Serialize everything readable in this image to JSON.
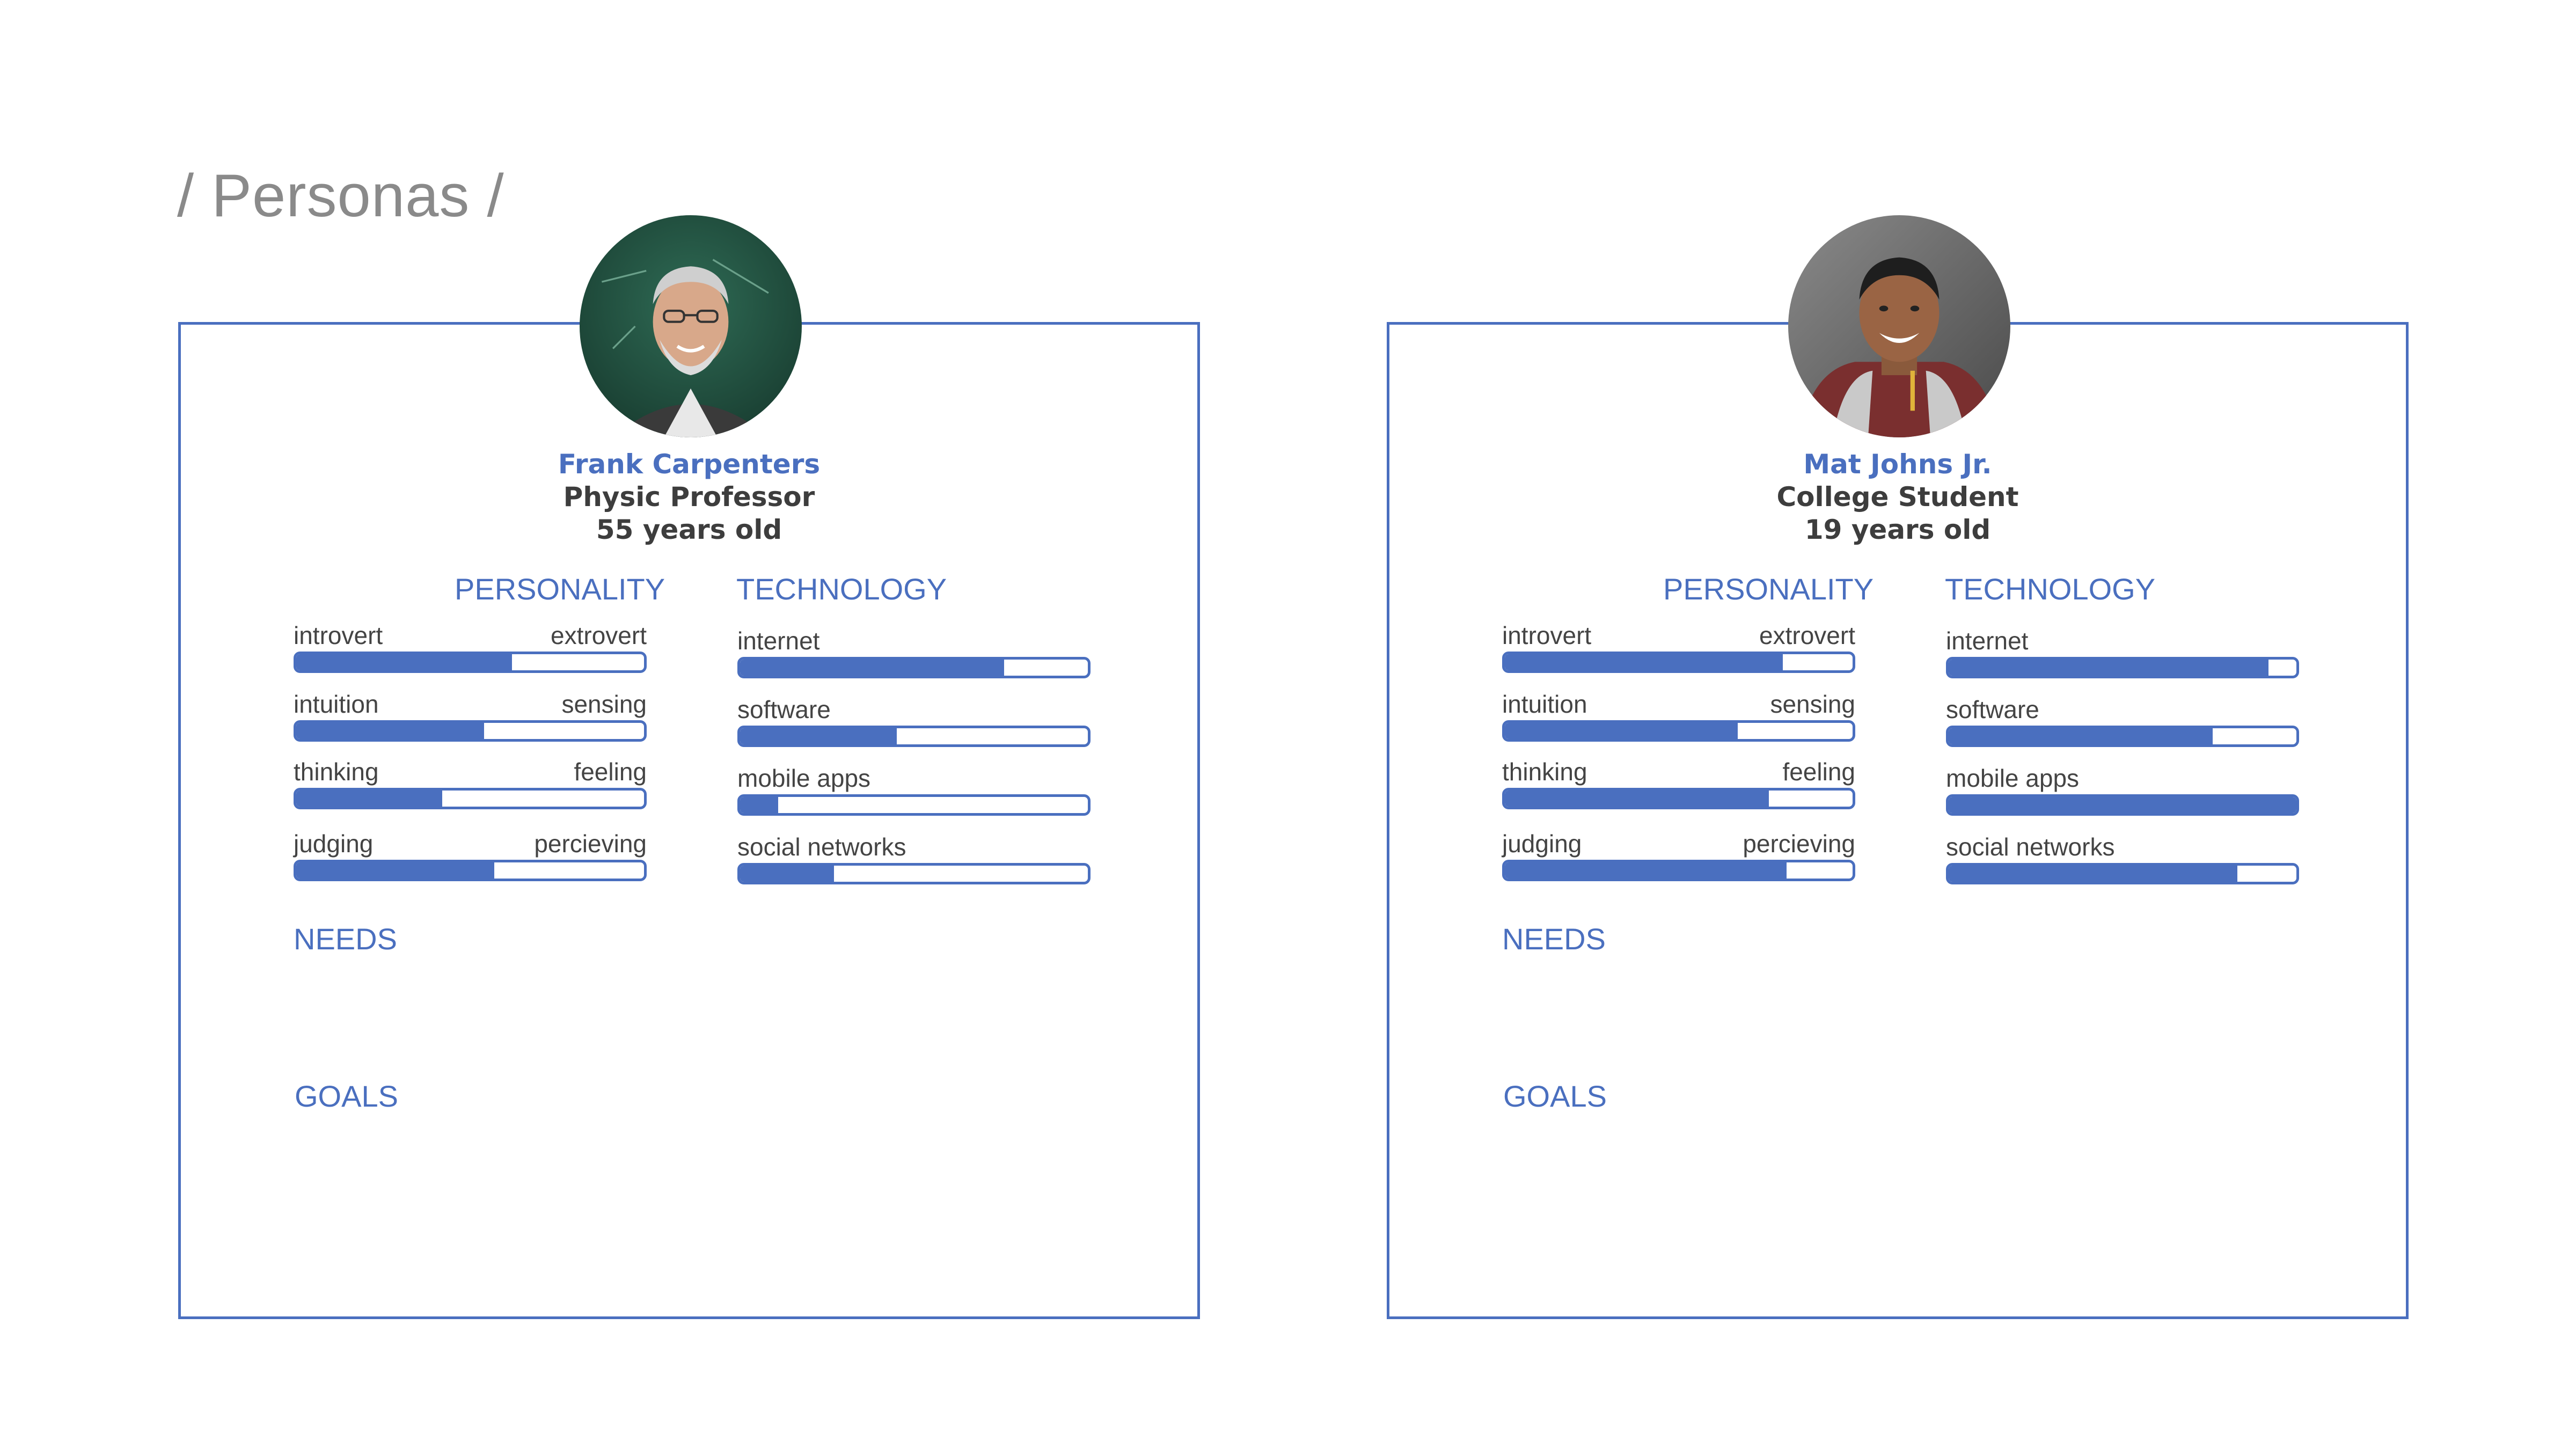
{
  "page": {
    "title": "/ Personas /"
  },
  "personas": [
    {
      "name": "Frank Carpenters",
      "role": "Physic Professor",
      "age": "55 years old",
      "avatar_icon": "person-photo-icon",
      "personality_label": "PERSONALITY",
      "technology_label": "TECHNOLOGY",
      "needs_label": "NEEDS",
      "goals_label": "GOALS",
      "personality": [
        {
          "left": "introvert",
          "right": "extrovert",
          "value": 0.62
        },
        {
          "left": "intuition",
          "right": "sensing",
          "value": 0.54
        },
        {
          "left": "thinking",
          "right": "feeling",
          "value": 0.42
        },
        {
          "left": "judging",
          "right": "percieving",
          "value": 0.57
        }
      ],
      "technology": [
        {
          "label": "internet",
          "value": 0.76
        },
        {
          "label": "software",
          "value": 0.45
        },
        {
          "label": "mobile apps",
          "value": 0.11
        },
        {
          "label": "social networks",
          "value": 0.27
        }
      ]
    },
    {
      "name": "Mat Johns Jr.",
      "role": "College Student",
      "age": "19 years old",
      "avatar_icon": "person-photo-icon",
      "personality_label": "PERSONALITY",
      "technology_label": "TECHNOLOGY",
      "needs_label": "NEEDS",
      "goals_label": "GOALS",
      "personality": [
        {
          "left": "introvert",
          "right": "extrovert",
          "value": 0.8
        },
        {
          "left": "intuition",
          "right": "sensing",
          "value": 0.67
        },
        {
          "left": "thinking",
          "right": "feeling",
          "value": 0.76
        },
        {
          "left": "judging",
          "right": "percieving",
          "value": 0.81
        }
      ],
      "technology": [
        {
          "label": "internet",
          "value": 0.92
        },
        {
          "label": "software",
          "value": 0.76
        },
        {
          "label": "mobile apps",
          "value": 1.0
        },
        {
          "label": "social networks",
          "value": 0.83
        }
      ]
    }
  ],
  "colors": {
    "accent": "#4a6fbf",
    "title_gray": "#8a8a8a",
    "text_dark": "#3d3d3d"
  }
}
